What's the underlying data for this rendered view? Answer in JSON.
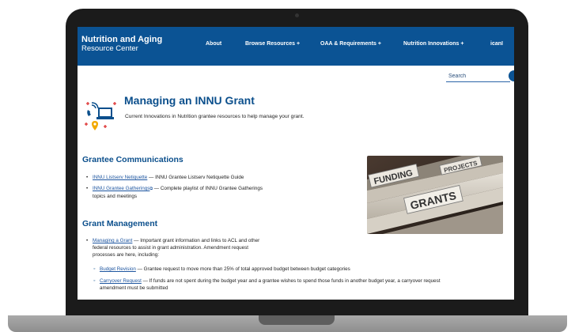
{
  "nav": {
    "brand_line1": "Nutrition and Aging",
    "brand_line2": "Resource Center",
    "items": [
      {
        "label": "About"
      },
      {
        "label": "Browse Resources +"
      },
      {
        "label": "OAA & Requirements +"
      },
      {
        "label": "Nutrition Innovations +"
      },
      {
        "label": "icanI"
      }
    ]
  },
  "search": {
    "placeholder": "Search"
  },
  "header": {
    "title": "Managing an INNU Grant",
    "subtitle": "Current Innovations in Nutrition grantee resources to help manage your grant."
  },
  "communications": {
    "heading": "Grantee Communications",
    "items": [
      {
        "link": "INNU Listserv Netiquette",
        "text": " — INNU Grantee Listserv Netiquette Guide"
      },
      {
        "link": "INNU Grantee Gatherings",
        "text": " — Complete playlist of INNU Grantee Gatherings",
        "text2": "topics and meetings"
      }
    ]
  },
  "management": {
    "heading": "Grant Management",
    "items": [
      {
        "link": "Managing a Grant",
        "text": " — Important grant information and links to ACL and other",
        "text2": "federal resources to assist in grant administration. Amendment request",
        "text3": "processes are here, including:"
      }
    ],
    "subitems": [
      {
        "link": "Budget Revision",
        "text": " — Grantee request to move more than 25% of total approved budget between budget categories"
      },
      {
        "link": "Carryover Request",
        "text": " — If funds are not spent during the budget year and a grantee wishes to spend those funds in another budget year, a carryover request",
        "text2": "amendment must be submitted"
      }
    ]
  },
  "image": {
    "tab1": "FUNDING",
    "tab2": "PROJECTS",
    "tab3": "GRANTS"
  },
  "colors": {
    "nav": "#0b5394",
    "heading": "#0b4f8c",
    "link": "#1e56a0"
  },
  "icons": {
    "header": "phone-laptop-location-icon",
    "external": "external-link-icon"
  }
}
